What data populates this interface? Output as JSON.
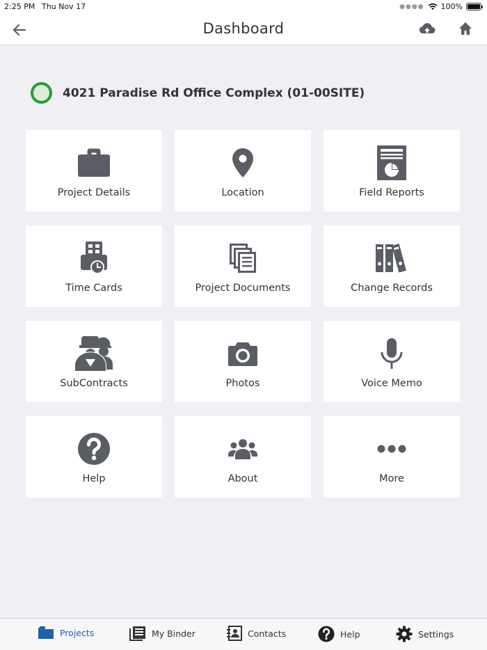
{
  "status": {
    "time": "2:25 PM",
    "date": "Thu Nov 17",
    "battery": "100%"
  },
  "nav": {
    "title": "Dashboard"
  },
  "project": {
    "name": "4021 Paradise Rd Office Complex  (01-00SITE)",
    "status_color": "#2e9a3c"
  },
  "tiles": [
    {
      "label": "Project Details",
      "icon": "briefcase-icon"
    },
    {
      "label": "Location",
      "icon": "map-pin-icon"
    },
    {
      "label": "Field Reports",
      "icon": "report-chart-icon"
    },
    {
      "label": "Time Cards",
      "icon": "time-card-icon"
    },
    {
      "label": "Project Documents",
      "icon": "documents-stack-icon"
    },
    {
      "label": "Change Records",
      "icon": "binders-icon"
    },
    {
      "label": "SubContracts",
      "icon": "workers-hardhat-icon"
    },
    {
      "label": "Photos",
      "icon": "camera-icon"
    },
    {
      "label": "Voice Memo",
      "icon": "microphone-icon"
    },
    {
      "label": "Help",
      "icon": "question-circle-icon"
    },
    {
      "label": "About",
      "icon": "people-group-icon"
    },
    {
      "label": "More",
      "icon": "ellipsis-icon"
    }
  ],
  "tabs": [
    {
      "label": "Projects",
      "icon": "folder-icon",
      "active": true
    },
    {
      "label": "My Binder",
      "icon": "binder-icon",
      "active": false
    },
    {
      "label": "Contacts",
      "icon": "contacts-book-icon",
      "active": false
    },
    {
      "label": "Help",
      "icon": "question-circle-icon",
      "active": false
    },
    {
      "label": "Settings",
      "icon": "gear-icon",
      "active": false
    }
  ],
  "colors": {
    "icon_gray": "#5a5d64",
    "accent": "#1f63ad",
    "background": "#efeff4"
  }
}
